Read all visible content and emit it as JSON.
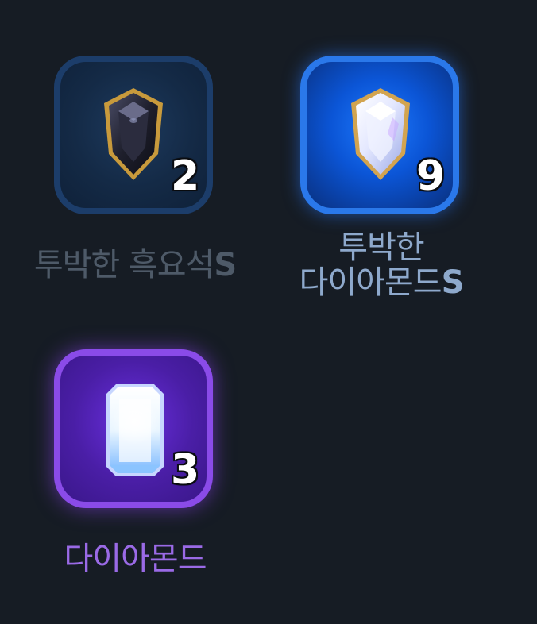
{
  "inventory": {
    "items": [
      {
        "name": "투박한 흑요석",
        "suffix": "S",
        "count": "2",
        "icon": "obsidian-gem-icon",
        "colors": {
          "frame": "#1c3d6a",
          "label": "#4e5a68"
        }
      },
      {
        "name_line1": "투박한",
        "name_line2": "다이아몬드",
        "suffix": "S",
        "count": "9",
        "icon": "clear-diamond-gem-icon",
        "colors": {
          "frame": "#2a78ea",
          "label": "#8ea9cc"
        }
      },
      {
        "name": "다이아몬드",
        "count": "3",
        "icon": "diamond-crystal-icon",
        "colors": {
          "frame": "#8a4be8",
          "label": "#9a6ae6"
        }
      }
    ]
  }
}
